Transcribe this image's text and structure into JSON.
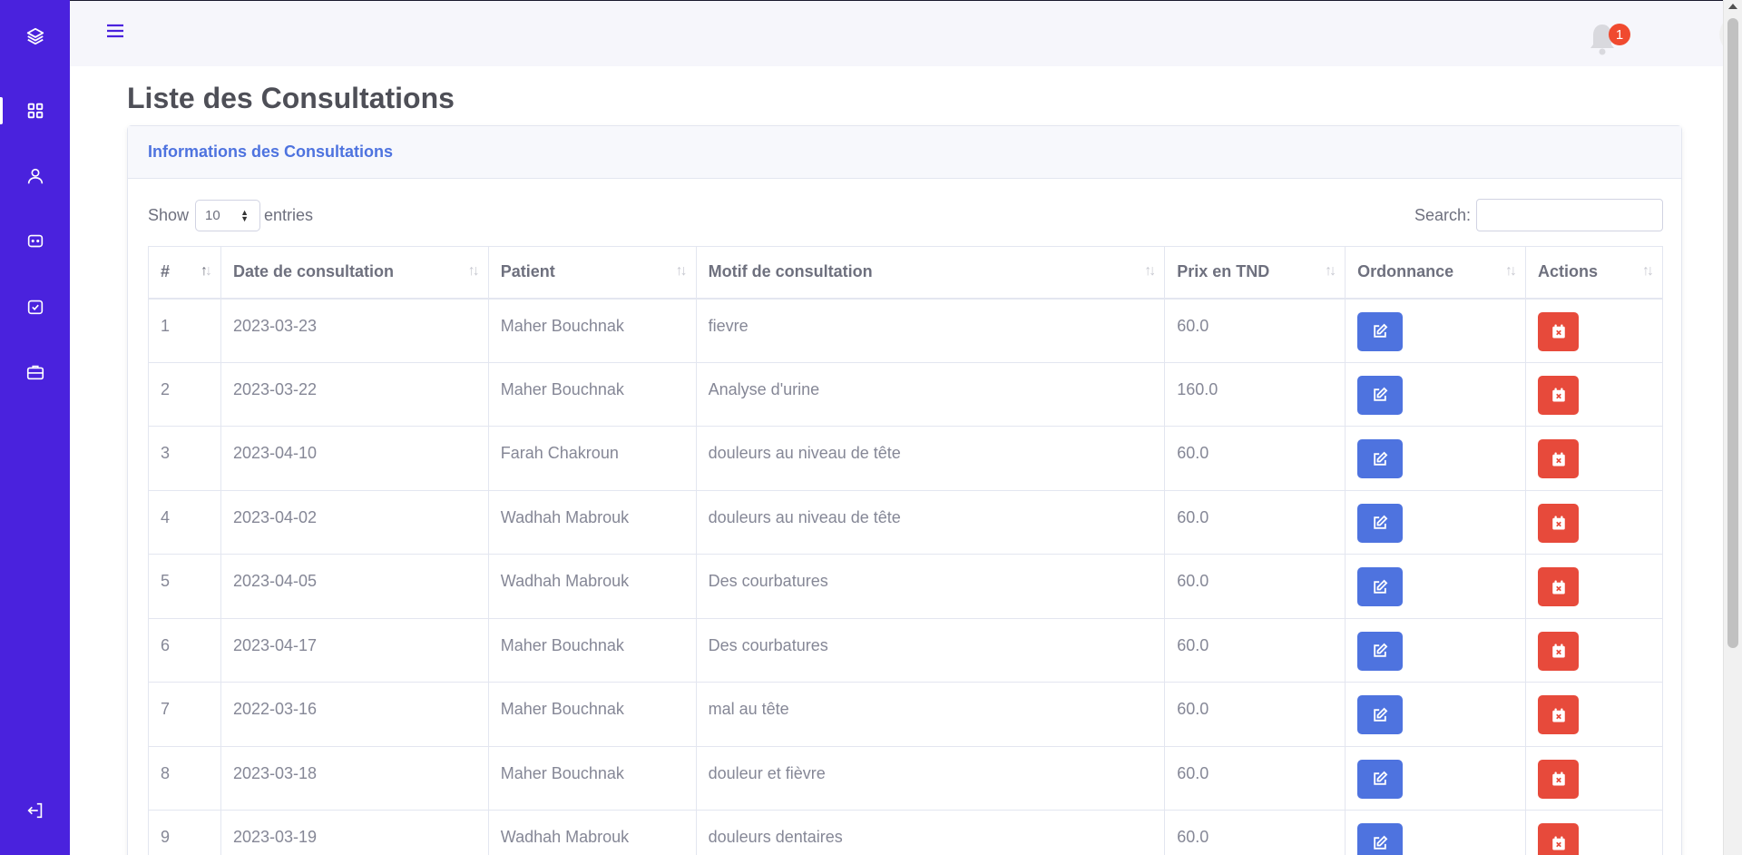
{
  "sidebar": {
    "items": [
      {
        "icon": "layers-icon"
      },
      {
        "icon": "dashboard-icon"
      },
      {
        "icon": "user-icon"
      },
      {
        "icon": "chat-icon"
      },
      {
        "icon": "calendar-check-icon"
      },
      {
        "icon": "briefcase-icon"
      },
      {
        "icon": "logout-icon"
      }
    ]
  },
  "topbar": {
    "notification_count": "1"
  },
  "page": {
    "title": "Liste des Consultations"
  },
  "card": {
    "title": "Informations des Consultations"
  },
  "controls": {
    "show_label": "Show",
    "length_value": "10",
    "entries_label": "entries",
    "search_label": "Search:",
    "search_value": ""
  },
  "table": {
    "headers": [
      "#",
      "Date de consultation",
      "Patient",
      "Motif de consultation",
      "Prix en TND",
      "Ordonnance",
      "Actions"
    ],
    "rows": [
      {
        "id": "1",
        "date": "2023-03-23",
        "patient": "Maher Bouchnak",
        "motif": "fievre",
        "prix": "60.0"
      },
      {
        "id": "2",
        "date": "2023-03-22",
        "patient": "Maher Bouchnak",
        "motif": "Analyse d'urine",
        "prix": "160.0"
      },
      {
        "id": "3",
        "date": "2023-04-10",
        "patient": "Farah Chakroun",
        "motif": "douleurs au niveau de tête",
        "prix": "60.0"
      },
      {
        "id": "4",
        "date": "2023-04-02",
        "patient": "Wadhah Mabrouk",
        "motif": "douleurs au niveau de tête",
        "prix": "60.0"
      },
      {
        "id": "5",
        "date": "2023-04-05",
        "patient": "Wadhah Mabrouk",
        "motif": "Des courbatures",
        "prix": "60.0"
      },
      {
        "id": "6",
        "date": "2023-04-17",
        "patient": "Maher Bouchnak",
        "motif": "Des courbatures",
        "prix": "60.0"
      },
      {
        "id": "7",
        "date": "2022-03-16",
        "patient": "Maher Bouchnak",
        "motif": "mal au tête",
        "prix": "60.0"
      },
      {
        "id": "8",
        "date": "2023-03-18",
        "patient": "Maher Bouchnak",
        "motif": "douleur et fièvre",
        "prix": "60.0"
      },
      {
        "id": "9",
        "date": "2023-03-19",
        "patient": "Wadhah Mabrouk",
        "motif": "douleurs dentaires",
        "prix": "60.0"
      }
    ]
  },
  "colors": {
    "sidebar": "#4a22dd",
    "primary": "#4e73df",
    "danger": "#e74a3b",
    "badge": "#f04a2f"
  }
}
